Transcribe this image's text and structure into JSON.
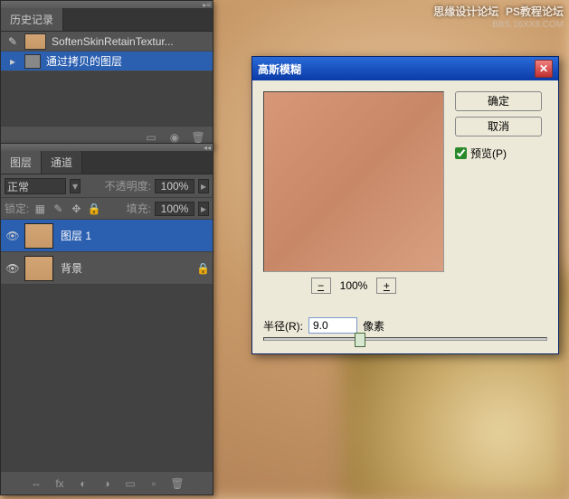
{
  "watermark": {
    "line1": "思缘设计论坛",
    "line2": "BBS.16XX8.COM",
    "line0": "PS教程论坛"
  },
  "history": {
    "tab": "历史记录",
    "items": [
      {
        "label": "SoftenSkinRetainTextur...",
        "thumb": true
      },
      {
        "label": "通过拷贝的图层",
        "thumb": false,
        "selected": true
      }
    ],
    "footer_icons": [
      "document-icon",
      "camera-icon",
      "trash-icon"
    ]
  },
  "layers": {
    "tabs": [
      "图层",
      "通道"
    ],
    "blend_mode": "正常",
    "opacity_label": "不透明度:",
    "opacity_value": "100%",
    "lock_label": "锁定:",
    "fill_label": "填充:",
    "fill_value": "100%",
    "items": [
      {
        "name": "图层 1",
        "selected": true,
        "locked": false
      },
      {
        "name": "背景",
        "selected": false,
        "locked": true
      }
    ]
  },
  "dialog": {
    "title": "高斯模糊",
    "ok": "确定",
    "cancel": "取消",
    "preview_label": "预览(P)",
    "preview_checked": true,
    "zoom_value": "100%",
    "zoom_minus": "−",
    "zoom_plus": "+",
    "radius_label": "半径(R):",
    "radius_value": "9.0",
    "radius_unit": "像素"
  },
  "chart_data": null
}
